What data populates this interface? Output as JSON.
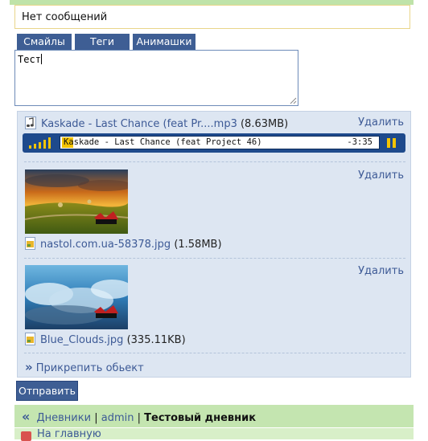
{
  "notice": {
    "text": "Нет сообщений"
  },
  "tabs": [
    {
      "label": "Смайлы"
    },
    {
      "label": "Теги"
    },
    {
      "label": "Анимашки"
    }
  ],
  "message": {
    "value": "Тест"
  },
  "attachments": {
    "delete_label": "Удалить",
    "audio": {
      "name": "Kaskade - Last Chance (feat Pr....mp3",
      "size": "(8.63MB)",
      "player_title": "Kaskade - Last Chance (feat Project 46)",
      "player_time": "-3:35"
    },
    "images": [
      {
        "name": "nastol.com.ua-58378.jpg",
        "size": "(1.58MB)"
      },
      {
        "name": "Blue_Clouds.jpg",
        "size": "(335.11KB)"
      }
    ],
    "attach_label": "Прикрепить обьект"
  },
  "submit_label": "Отправить",
  "breadcrumb": {
    "items": [
      "Дневники",
      "admin"
    ],
    "separator": "|",
    "current": "Тестовый дневник"
  },
  "home_link": "На главную"
}
